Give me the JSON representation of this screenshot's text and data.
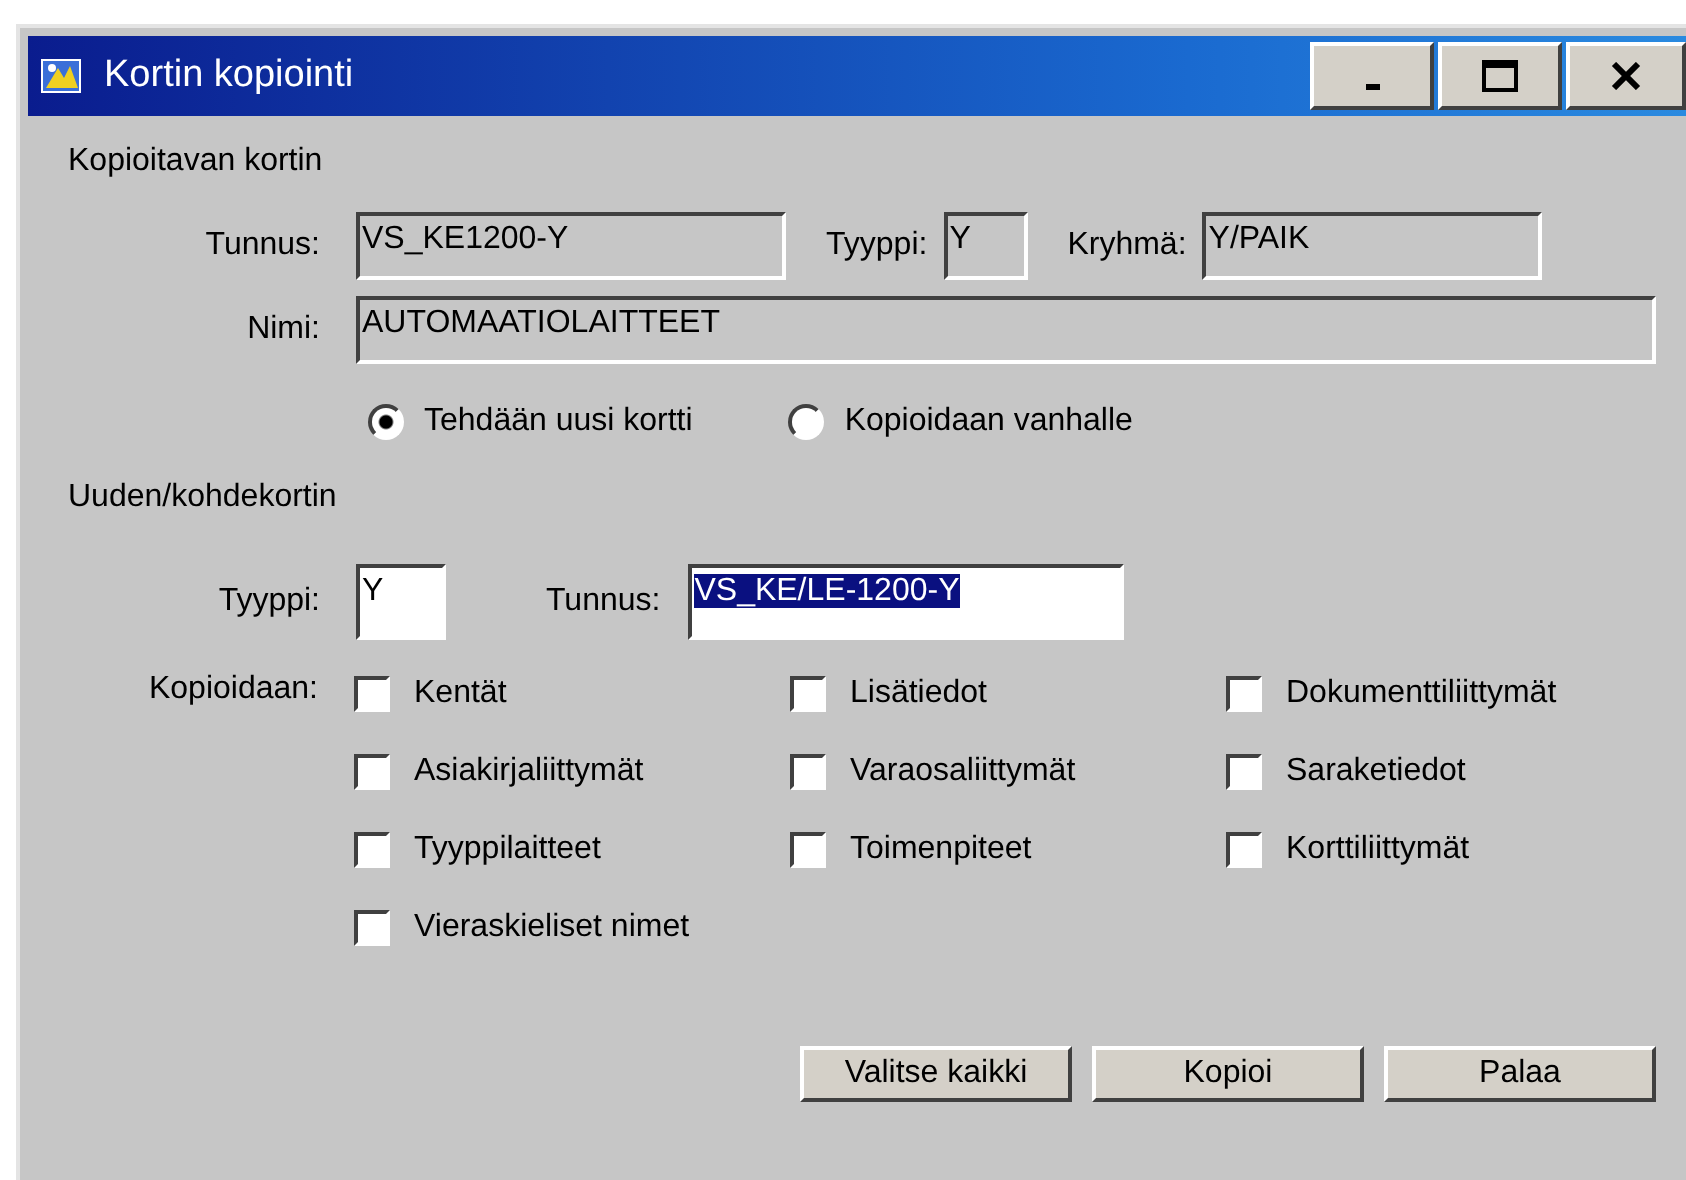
{
  "window": {
    "title": "Kortin kopiointi"
  },
  "source": {
    "heading": "Kopioitavan kortin",
    "fields": [
      {
        "label": "Tunnus:",
        "value": "VS_KE1200-Y"
      },
      {
        "label": "Tyyppi:",
        "value": "Y"
      },
      {
        "label": "Kryhmä:",
        "value": "Y/PAIK"
      }
    ],
    "name": {
      "label": "Nimi:",
      "value": "AUTOMAATIOLAITTEET"
    },
    "modes": [
      {
        "label": "Tehdään uusi kortti",
        "selected": true
      },
      {
        "label": "Kopioidaan vanhalle",
        "selected": false
      }
    ]
  },
  "target": {
    "heading": "Uuden/kohdekortin",
    "type": {
      "label": "Tyyppi:",
      "value": "Y"
    },
    "id": {
      "label": "Tunnus:",
      "value": "VS_KE/LE-1200-Y",
      "highlighted": true
    }
  },
  "copy": {
    "label": "Kopioidaan:",
    "options": [
      {
        "label": "Kentät",
        "checked": false
      },
      {
        "label": "Lisätiedot",
        "checked": false
      },
      {
        "label": "Dokumenttiliittymät",
        "checked": false
      },
      {
        "label": "Asiakirjaliittymät",
        "checked": false
      },
      {
        "label": "Varaosaliittymät",
        "checked": false
      },
      {
        "label": "Saraketiedot",
        "checked": false
      },
      {
        "label": "Tyyppilaitteet",
        "checked": false
      },
      {
        "label": "Toimenpiteet",
        "checked": false
      },
      {
        "label": "Korttiliittymät",
        "checked": false
      },
      {
        "label": "Vieraskieliset nimet",
        "checked": false
      }
    ]
  },
  "buttons": [
    "Valitse kaikki",
    "Kopioi",
    "Palaa"
  ]
}
